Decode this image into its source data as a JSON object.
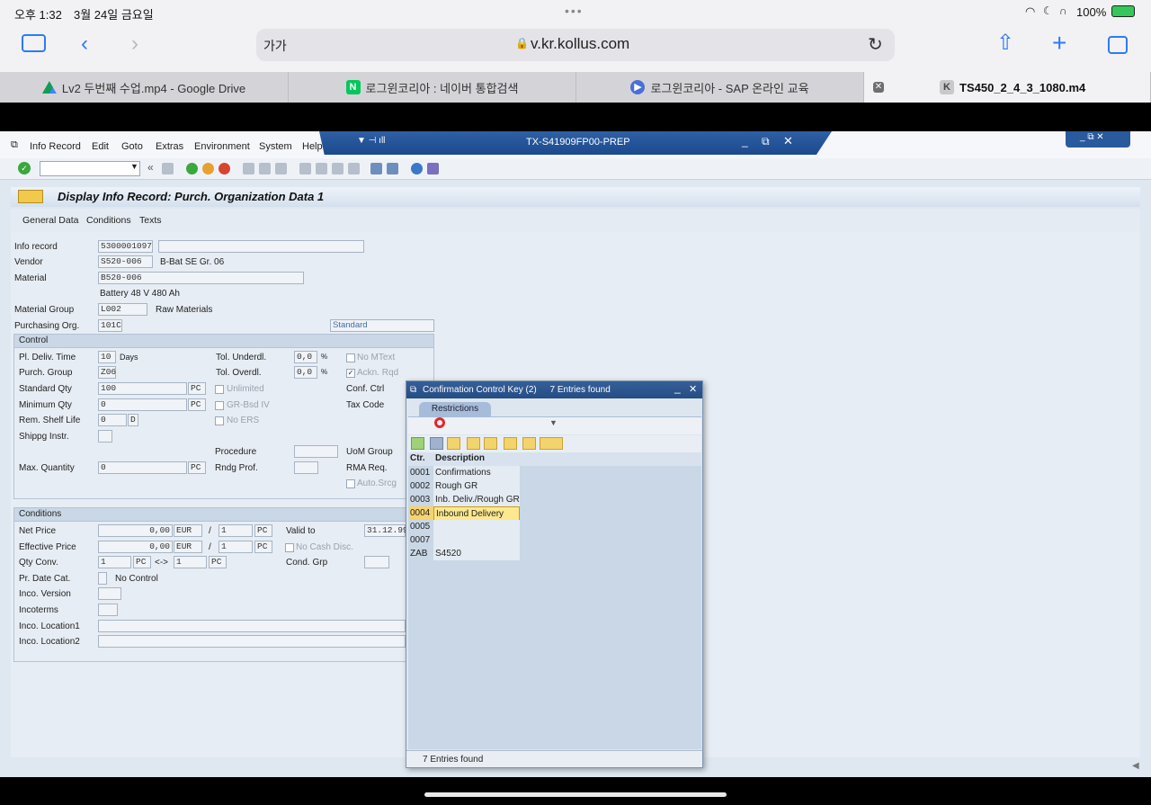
{
  "ipad": {
    "time": "오후 1:32",
    "date": "3월 24일 금요일",
    "battery": "100%",
    "address_left": "가가",
    "address": "v.kr.kollus.com"
  },
  "tabs": [
    {
      "label": "Lv2 두번째 수업.mp4 - Google Drive"
    },
    {
      "label": "로그윈코리아 : 네이버 통합검색",
      "favicon": "N"
    },
    {
      "label": "로그윈코리아 - SAP 온라인 교육"
    },
    {
      "label": "TS450_2_4_3_1080.m4",
      "favicon": "K"
    }
  ],
  "sap": {
    "menu": [
      "Info Record",
      "Edit",
      "Goto",
      "Extras",
      "Environment",
      "System",
      "Help"
    ],
    "system_title": "TX-S41909FP00-PREP",
    "screen_title": "Display Info Record: Purch. Organization Data 1",
    "screen_tabs": [
      "General Data",
      "Conditions",
      "Texts"
    ],
    "header": {
      "info_record_label": "Info record",
      "info_record": "5300001097",
      "vendor_label": "Vendor",
      "vendor": "S520-006",
      "vendor_name": "B-Bat SE Gr. 06",
      "material_label": "Material",
      "material": "B520-006",
      "material_desc": "Battery 48 V 480 Ah",
      "material_group_label": "Material Group",
      "material_group": "L002",
      "material_group_desc": "Raw Materials",
      "purch_org_label": "Purchasing Org.",
      "purch_org": "101C",
      "standard": "Standard"
    },
    "control": {
      "title": "Control",
      "pl_deliv_time_label": "Pl. Deliv. Time",
      "pl_deliv_time": "10",
      "days": "Days",
      "purch_group_label": "Purch. Group",
      "purch_group": "Z06",
      "standard_qty_label": "Standard Qty",
      "standard_qty": "100",
      "unit": "PC",
      "minimum_qty_label": "Minimum Qty",
      "minimum_qty": "0",
      "rem_shelf_life_label": "Rem. Shelf Life",
      "rem_shelf_life": "0",
      "shelf_unit": "D",
      "shipping_instr_label": "Shippg Instr.",
      "max_qty_label": "Max. Quantity",
      "max_qty": "0",
      "tol_underdl_label": "Tol. Underdl.",
      "tol_underdl": "0,0",
      "percent": "%",
      "tol_overdl_label": "Tol. Overdl.",
      "tol_overdl": "0,0",
      "unlimited": "Unlimited",
      "gr_bsd_iv": "GR-Bsd IV",
      "no_ers": "No ERS",
      "procedure_label": "Procedure",
      "rndg_prof_label": "Rndg Prof.",
      "no_mtext": "No MText",
      "ackn_rqd": "Ackn. Rqd",
      "conf_ctrl_label": "Conf. Ctrl",
      "tax_code_label": "Tax Code",
      "uom_group_label": "UoM Group",
      "rma_req_label": "RMA Req.",
      "auto_srcg": "Auto.Srcg"
    },
    "conditions": {
      "title": "Conditions",
      "net_price_label": "Net Price",
      "net_price": "0,00",
      "currency": "EUR",
      "per": "1",
      "per_unit": "PC",
      "eff_price_label": "Effective Price",
      "eff_price": "0,00",
      "qty_conv_label": "Qty Conv.",
      "qty_conv_1": "1",
      "arrow": "<->",
      "qty_conv_2": "1",
      "pr_date_cat_label": "Pr. Date Cat.",
      "pr_date_cat_text": "No Control",
      "inco_version_label": "Inco. Version",
      "incoterms_label": "Incoterms",
      "inco_loc1_label": "Inco. Location1",
      "inco_loc2_label": "Inco. Location2",
      "valid_to_label": "Valid to",
      "valid_to": "31.12.99",
      "no_cash_disc": "No Cash Disc.",
      "cond_grp_label": "Cond. Grp"
    },
    "popup": {
      "title": "Confirmation Control Key (2)",
      "found": "7 Entries found",
      "restrictions_tab": "Restrictions",
      "col_key": "Ctr.",
      "col_desc": "Description",
      "rows": [
        {
          "key": "0001",
          "desc": "Confirmations"
        },
        {
          "key": "0002",
          "desc": "Rough GR"
        },
        {
          "key": "0003",
          "desc": "Inb. Deliv./Rough GR"
        },
        {
          "key": "0004",
          "desc": "Inbound Delivery"
        },
        {
          "key": "0005",
          "desc": ""
        },
        {
          "key": "0007",
          "desc": ""
        },
        {
          "key": "ZAB",
          "desc": "S4520"
        }
      ],
      "footer": "7 Entries found"
    }
  }
}
